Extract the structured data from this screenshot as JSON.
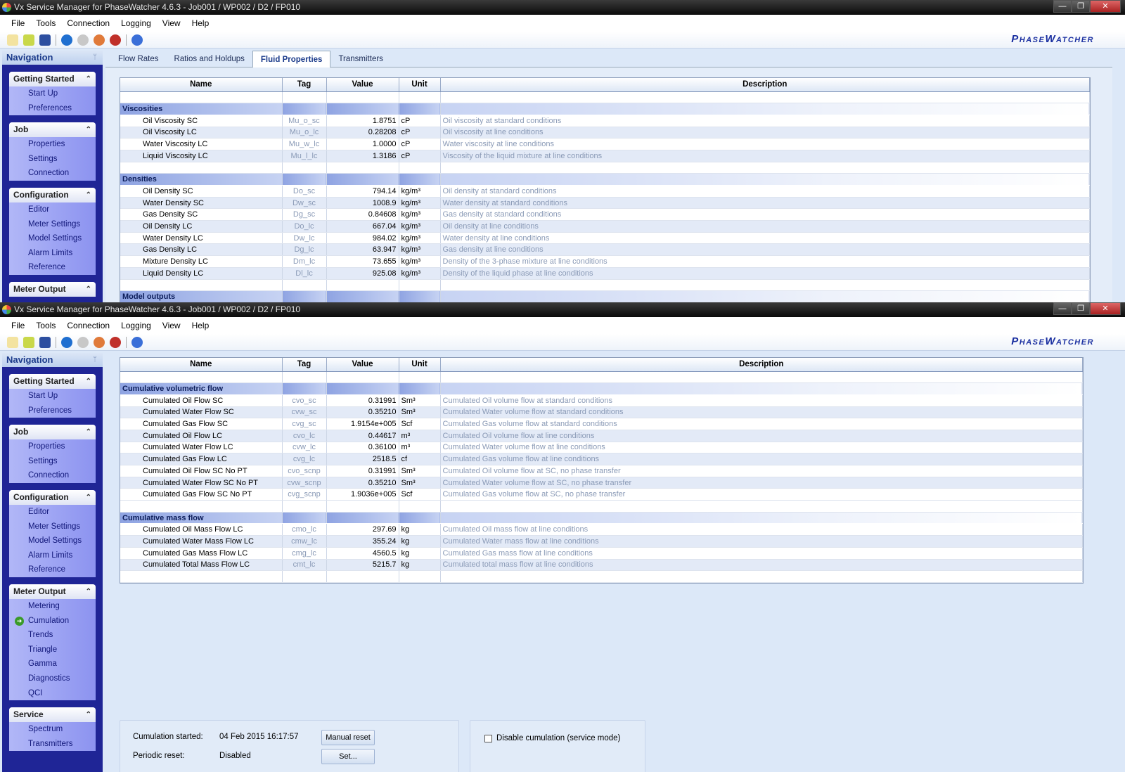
{
  "window_title": "Vx Service Manager for PhaseWatcher 4.6.3 - Job001 / WP002 / D2 / FP010",
  "window_buttons": {
    "minimize": "—",
    "restore": "❐",
    "close": "✕"
  },
  "menu": [
    "File",
    "Tools",
    "Connection",
    "Logging",
    "View",
    "Help"
  ],
  "toolbar_icons": [
    "new-icon",
    "open-icon",
    "save-icon",
    "download-icon",
    "person-icon",
    "user-icon",
    "refresh-icon",
    "help-icon"
  ],
  "logo": "PhaseWatcher",
  "navigation": {
    "title": "Navigation",
    "pin": "ᛘ"
  },
  "columns": [
    "Name",
    "Tag",
    "Value",
    "Unit",
    "Description"
  ],
  "window1": {
    "nav": [
      {
        "title": "Getting Started",
        "items": [
          "Start Up",
          "Preferences"
        ]
      },
      {
        "title": "Job",
        "items": [
          "Properties",
          "Settings",
          "Connection"
        ]
      },
      {
        "title": "Configuration",
        "items": [
          "Editor",
          "Meter Settings",
          "Model Settings",
          "Alarm Limits",
          "Reference"
        ]
      },
      {
        "title": "Meter Output",
        "items": []
      }
    ],
    "tabs": [
      "Flow Rates",
      "Ratios and Holdups",
      "Fluid Properties",
      "Transmitters"
    ],
    "active_tab": "Fluid Properties",
    "rows": [
      {
        "type": "blank"
      },
      {
        "type": "group",
        "name": "Viscosities"
      },
      {
        "name": "Oil Viscosity SC",
        "tag": "Mu_o_sc",
        "value": "1.8751",
        "unit": "cP",
        "desc": "Oil viscosity at standard conditions"
      },
      {
        "name": "Oil Viscosity LC",
        "tag": "Mu_o_lc",
        "value": "0.28208",
        "unit": "cP",
        "desc": "Oil viscosity at line conditions"
      },
      {
        "name": "Water Viscosity LC",
        "tag": "Mu_w_lc",
        "value": "1.0000",
        "unit": "cP",
        "desc": "Water viscosity at line conditions"
      },
      {
        "name": "Liquid Viscosity LC",
        "tag": "Mu_l_lc",
        "value": "1.3186",
        "unit": "cP",
        "desc": "Viscosity of the liquid mixture at line conditions"
      },
      {
        "type": "blank"
      },
      {
        "type": "group",
        "name": "Densities"
      },
      {
        "name": "Oil Density SC",
        "tag": "Do_sc",
        "value": "794.14",
        "unit": "kg/m³",
        "desc": "Oil density at standard conditions"
      },
      {
        "name": "Water Density SC",
        "tag": "Dw_sc",
        "value": "1008.9",
        "unit": "kg/m³",
        "desc": "Water density at standard conditions"
      },
      {
        "name": "Gas Density SC",
        "tag": "Dg_sc",
        "value": "0.84608",
        "unit": "kg/m³",
        "desc": "Gas density at standard conditions"
      },
      {
        "name": "Oil Density LC",
        "tag": "Do_lc",
        "value": "667.04",
        "unit": "kg/m³",
        "desc": "Oil density at line conditions"
      },
      {
        "name": "Water Density LC",
        "tag": "Dw_lc",
        "value": "984.02",
        "unit": "kg/m³",
        "desc": "Water density at line conditions"
      },
      {
        "name": "Gas Density LC",
        "tag": "Dg_lc",
        "value": "63.947",
        "unit": "kg/m³",
        "desc": "Gas density at line conditions"
      },
      {
        "name": "Mixture Density LC",
        "tag": "Dm_lc",
        "value": "73.655",
        "unit": "kg/m³",
        "desc": "Density of the 3-phase mixture at line conditions"
      },
      {
        "name": "Liquid Density LC",
        "tag": "Dl_lc",
        "value": "925.08",
        "unit": "kg/m³",
        "desc": "Density of the liquid phase at line conditions"
      },
      {
        "type": "blank"
      },
      {
        "type": "group",
        "name": "Model outputs"
      }
    ]
  },
  "window2": {
    "nav": [
      {
        "title": "Getting Started",
        "items": [
          "Start Up",
          "Preferences"
        ]
      },
      {
        "title": "Job",
        "items": [
          "Properties",
          "Settings",
          "Connection"
        ]
      },
      {
        "title": "Configuration",
        "items": [
          "Editor",
          "Meter Settings",
          "Model Settings",
          "Alarm Limits",
          "Reference"
        ]
      },
      {
        "title": "Meter Output",
        "items": [
          "Metering",
          "Cumulation",
          "Trends",
          "Triangle",
          "Gamma",
          "Diagnostics",
          "QCI"
        ]
      },
      {
        "title": "Service",
        "items": [
          "Spectrum",
          "Transmitters"
        ]
      }
    ],
    "current_item": "Cumulation",
    "rows": [
      {
        "type": "blank"
      },
      {
        "type": "group",
        "name": "Cumulative volumetric flow"
      },
      {
        "name": "Cumulated Oil Flow SC",
        "tag": "cvo_sc",
        "value": "0.31991",
        "unit": "Sm³",
        "desc": "Cumulated Oil volume flow at standard conditions"
      },
      {
        "name": "Cumulated Water Flow SC",
        "tag": "cvw_sc",
        "value": "0.35210",
        "unit": "Sm³",
        "desc": "Cumulated Water volume flow at standard conditions"
      },
      {
        "name": "Cumulated Gas Flow SC",
        "tag": "cvg_sc",
        "value": "1.9154e+005",
        "unit": "Scf",
        "desc": "Cumulated Gas volume flow at standard conditions"
      },
      {
        "name": "Cumulated Oil Flow LC",
        "tag": "cvo_lc",
        "value": "0.44617",
        "unit": "m³",
        "desc": "Cumulated Oil volume flow at line conditions"
      },
      {
        "name": "Cumulated Water Flow LC",
        "tag": "cvw_lc",
        "value": "0.36100",
        "unit": "m³",
        "desc": "Cumulated Water volume flow at line conditions"
      },
      {
        "name": "Cumulated Gas Flow LC",
        "tag": "cvg_lc",
        "value": "2518.5",
        "unit": "cf",
        "desc": "Cumulated Gas volume flow at line conditions"
      },
      {
        "name": "Cumulated Oil Flow SC No PT",
        "tag": "cvo_scnp",
        "value": "0.31991",
        "unit": "Sm³",
        "desc": "Cumulated Oil volume flow at SC, no phase transfer"
      },
      {
        "name": "Cumulated Water Flow SC No PT",
        "tag": "cvw_scnp",
        "value": "0.35210",
        "unit": "Sm³",
        "desc": "Cumulated Water volume flow at SC, no phase transfer"
      },
      {
        "name": "Cumulated Gas Flow SC No PT",
        "tag": "cvg_scnp",
        "value": "1.9036e+005",
        "unit": "Scf",
        "desc": "Cumulated Gas volume flow at SC, no phase transfer"
      },
      {
        "type": "blank"
      },
      {
        "type": "group",
        "name": "Cumulative mass flow"
      },
      {
        "name": "Cumulated Oil Mass Flow LC",
        "tag": "cmo_lc",
        "value": "297.69",
        "unit": "kg",
        "desc": "Cumulated Oil mass flow at line conditions"
      },
      {
        "name": "Cumulated Water Mass Flow LC",
        "tag": "cmw_lc",
        "value": "355.24",
        "unit": "kg",
        "desc": "Cumulated Water mass flow at line conditions"
      },
      {
        "name": "Cumulated Gas Mass Flow LC",
        "tag": "cmg_lc",
        "value": "4560.5",
        "unit": "kg",
        "desc": "Cumulated Gas mass flow at line conditions"
      },
      {
        "name": "Cumulated Total Mass Flow LC",
        "tag": "cmt_lc",
        "value": "5215.7",
        "unit": "kg",
        "desc": "Cumulated total mass flow at line conditions"
      },
      {
        "type": "blank"
      }
    ],
    "cumulation": {
      "started_label": "Cumulation started:",
      "started_value": "04 Feb 2015 16:17:57",
      "reset_label": "Periodic reset:",
      "reset_value": "Disabled",
      "manual_reset": "Manual reset",
      "set": "Set...",
      "disable_label": "Disable cumulation (service mode)",
      "disable_checked": false
    }
  }
}
